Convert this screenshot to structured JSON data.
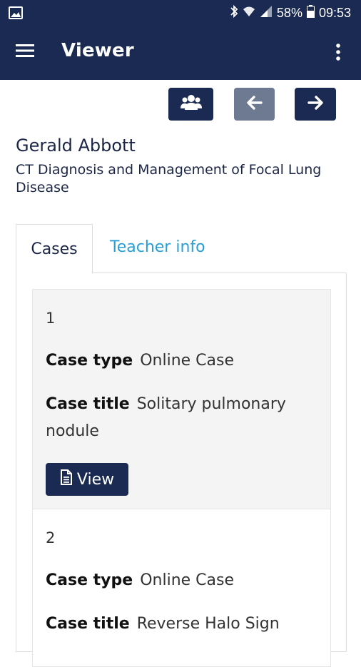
{
  "status_bar": {
    "battery": "58%",
    "time": "09:53",
    "icons": [
      "image-icon",
      "bluetooth-icon",
      "wifi-icon",
      "signal-icon",
      "battery-icon"
    ]
  },
  "app_bar": {
    "title": "Viewer",
    "menu_icon": "hamburger-menu-icon",
    "overflow_icon": "more-vert-icon"
  },
  "toolbar": {
    "group_icon": "users-group-icon",
    "prev_icon": "arrow-left-icon",
    "next_icon": "arrow-right-icon",
    "prev_disabled": true
  },
  "course": {
    "author": "Gerald Abbott",
    "title": "CT Diagnosis and Management of Focal Lung Disease"
  },
  "tabs": [
    {
      "label": "Cases",
      "active": true
    },
    {
      "label": "Teacher info",
      "active": false
    }
  ],
  "cases": [
    {
      "number": "1",
      "type_label": "Case type",
      "type_value": "Online Case",
      "title_label": "Case title",
      "title_value": "Solitary pulmonary nodule",
      "view_label": "View"
    },
    {
      "number": "2",
      "type_label": "Case type",
      "type_value": "Online Case",
      "title_label": "Case title",
      "title_value": "Reverse Halo Sign"
    }
  ],
  "colors": {
    "primary": "#1a2a52",
    "disabled": "#6e7a91",
    "link": "#2a9fd6"
  }
}
